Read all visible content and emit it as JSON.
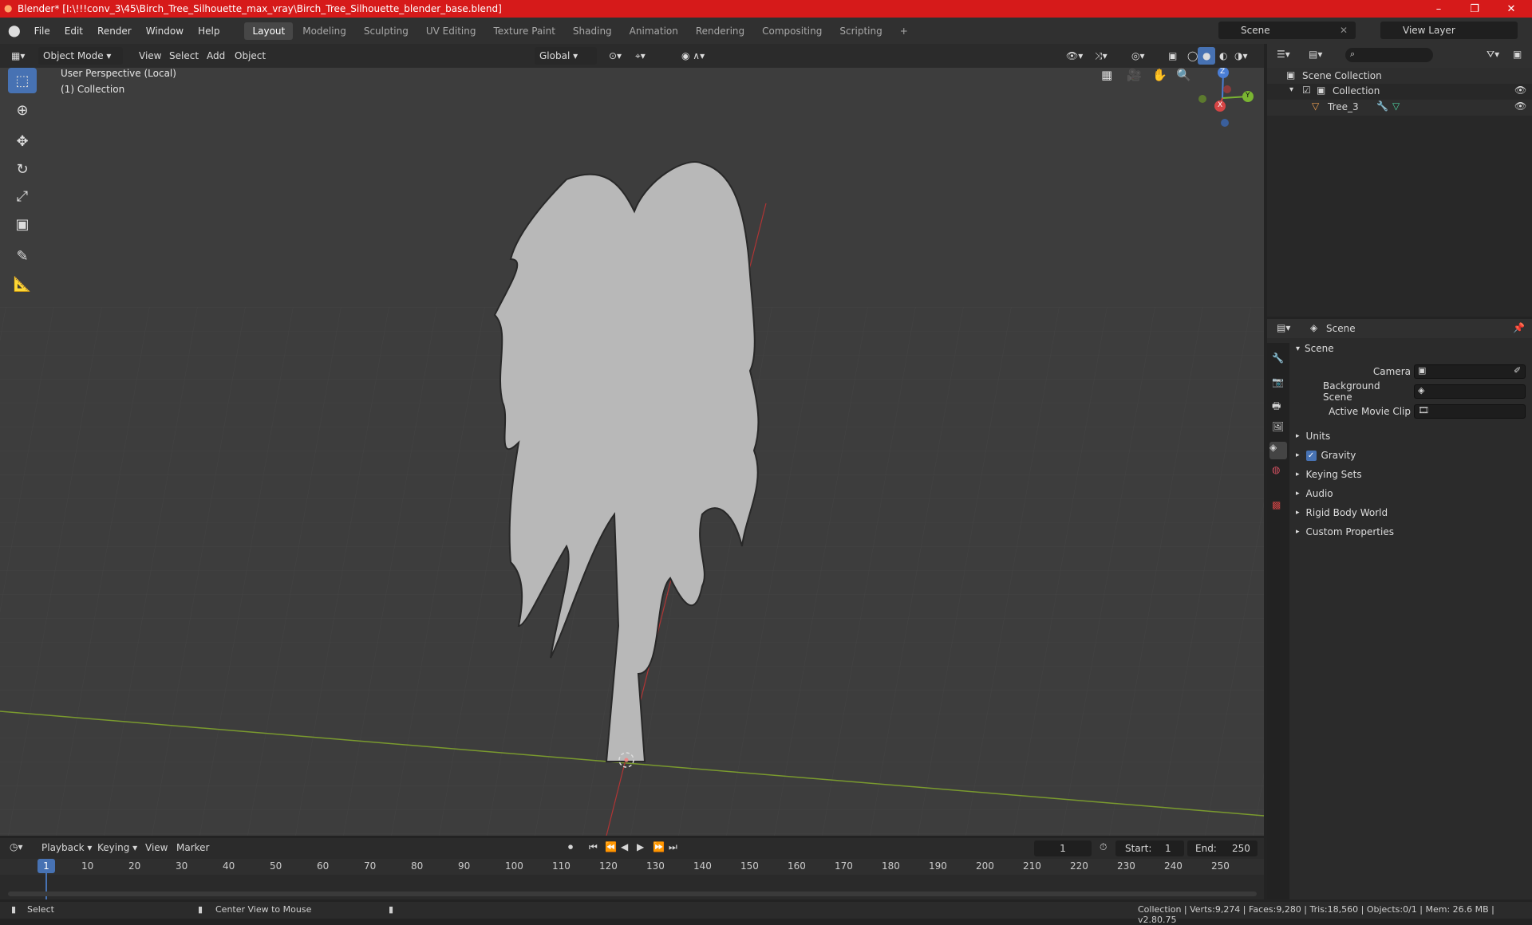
{
  "window": {
    "title": "Blender* [I:\\!!!conv_3\\45\\Birch_Tree_Silhouette_max_vray\\Birch_Tree_Silhouette_blender_base.blend]",
    "minimize": "–",
    "maximize": "❐",
    "close": "✕"
  },
  "menu": {
    "items": [
      "File",
      "Edit",
      "Render",
      "Window",
      "Help"
    ],
    "workspaces": [
      "Layout",
      "Modeling",
      "Sculpting",
      "UV Editing",
      "Texture Paint",
      "Shading",
      "Animation",
      "Rendering",
      "Compositing",
      "Scripting"
    ],
    "active_workspace": "Layout",
    "add_tab": "+",
    "scene": "Scene",
    "view_layer": "View Layer"
  },
  "viewport_header": {
    "mode": "Object Mode",
    "view": "View",
    "select": "Select",
    "add": "Add",
    "object": "Object",
    "transform": "Global"
  },
  "viewport": {
    "perspective": "User Perspective (Local)",
    "collection": "(1) Collection",
    "gizmo": {
      "z": "Z",
      "y": "Y",
      "x": "X"
    }
  },
  "outliner": {
    "root": "Scene Collection",
    "collection": "Collection",
    "object": "Tree_3"
  },
  "properties": {
    "context": "Scene",
    "panel": "Scene",
    "camera_label": "Camera",
    "bg_scene_label": "Background Scene",
    "movie_clip_label": "Active Movie Clip",
    "sections": [
      "Units",
      "Gravity",
      "Keying Sets",
      "Audio",
      "Rigid Body World",
      "Custom Properties"
    ]
  },
  "timeline": {
    "playback": "Playback",
    "keying": "Keying",
    "view": "View",
    "marker": "Marker",
    "current_frame": "1",
    "start_label": "Start:",
    "start": "1",
    "end_label": "End:",
    "end": "250",
    "ruler": [
      "10",
      "20",
      "30",
      "40",
      "50",
      "60",
      "70",
      "80",
      "90",
      "100",
      "110",
      "120",
      "130",
      "140",
      "150",
      "160",
      "170",
      "180",
      "190",
      "200",
      "210",
      "220",
      "230",
      "240",
      "250"
    ],
    "playhead_label": "1"
  },
  "status": {
    "select": "Select",
    "center": "Center View to Mouse",
    "stats": "Collection | Verts:9,274 | Faces:9,280 | Tris:18,560 | Objects:0/1 | Mem: 26.6 MB | v2.80.75"
  }
}
